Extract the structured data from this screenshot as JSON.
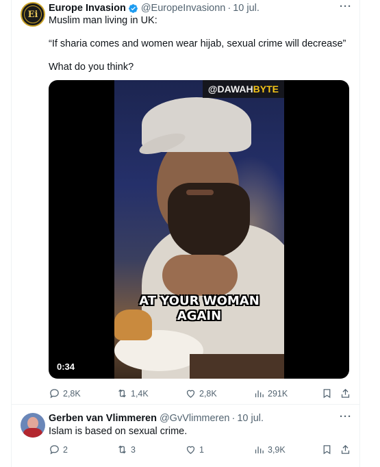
{
  "tweet1": {
    "display_name": "Europe Invasion",
    "handle": "@EuropeInvasionn",
    "date": "10 jul.",
    "avatar_text": "Ei",
    "text_line1": "Muslim man living in UK:",
    "text_line2": "“If sharia comes and women wear hijab, sexual crime will decrease”",
    "text_line3": "What do you think?",
    "video": {
      "watermark_part1": "@DAWAH",
      "watermark_part2": "BYTE",
      "caption_line1": "AT YOUR WOMAN",
      "caption_line2": "AGAIN",
      "duration": "0:34"
    },
    "actions": {
      "replies": "2,8K",
      "reposts": "1,4K",
      "likes": "2,8K",
      "views": "291K"
    }
  },
  "tweet2": {
    "display_name": "Gerben van Vlimmeren",
    "handle": "@GvVlimmeren",
    "date": "10 jul.",
    "text": "Islam is based on sexual crime.",
    "actions": {
      "replies": "2",
      "reposts": "3",
      "likes": "1",
      "views": "3,9K"
    }
  },
  "colors": {
    "verified": "#1d9bf0",
    "secondary_text": "#536471",
    "watermark_accent": "#f5c518"
  }
}
